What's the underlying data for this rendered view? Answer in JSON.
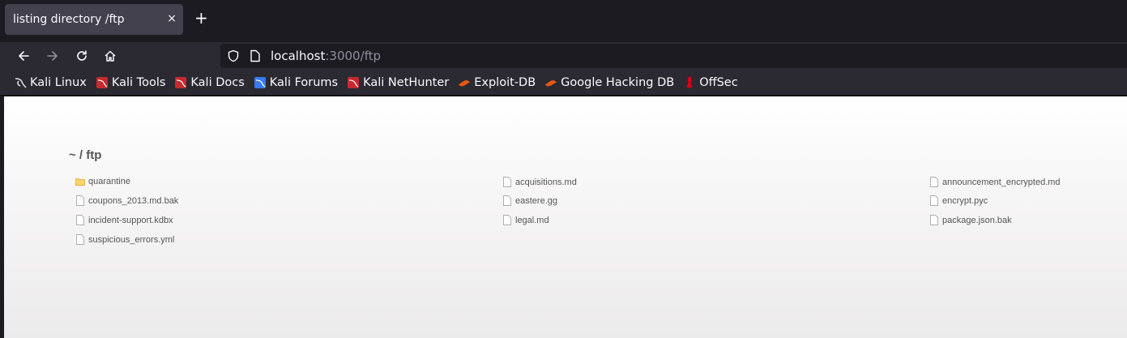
{
  "tab": {
    "title": "listing directory /ftp",
    "close": "×",
    "new": "+"
  },
  "nav": {
    "back": "back-arrow-icon",
    "forward": "forward-arrow-icon",
    "reload": "reload-icon",
    "home": "home-icon"
  },
  "url": {
    "host": "localhost",
    "rest": ":3000/ftp"
  },
  "bookmarks": [
    {
      "label": "Kali Linux",
      "icon": "kali-dragon-icon"
    },
    {
      "label": "Kali Tools",
      "icon": "kali-tools-icon"
    },
    {
      "label": "Kali Docs",
      "icon": "kali-docs-icon"
    },
    {
      "label": "Kali Forums",
      "icon": "kali-forums-icon"
    },
    {
      "label": "Kali NetHunter",
      "icon": "kali-nethunter-icon"
    },
    {
      "label": "Exploit-DB",
      "icon": "exploit-db-icon"
    },
    {
      "label": "Google Hacking DB",
      "icon": "ghdb-icon"
    },
    {
      "label": "OffSec",
      "icon": "offsec-icon"
    }
  ],
  "listing": {
    "heading": "~ / ftp",
    "files": [
      {
        "name": "quarantine",
        "type": "folder"
      },
      {
        "name": "acquisitions.md",
        "type": "file"
      },
      {
        "name": "announcement_encrypted.md",
        "type": "file"
      },
      {
        "name": "coupons_2013.md.bak",
        "type": "file"
      },
      {
        "name": "eastere.gg",
        "type": "file"
      },
      {
        "name": "encrypt.pyc",
        "type": "file"
      },
      {
        "name": "incident-support.kdbx",
        "type": "file"
      },
      {
        "name": "legal.md",
        "type": "file"
      },
      {
        "name": "package.json.bak",
        "type": "file"
      },
      {
        "name": "suspicious_errors.yml",
        "type": "file"
      }
    ]
  }
}
